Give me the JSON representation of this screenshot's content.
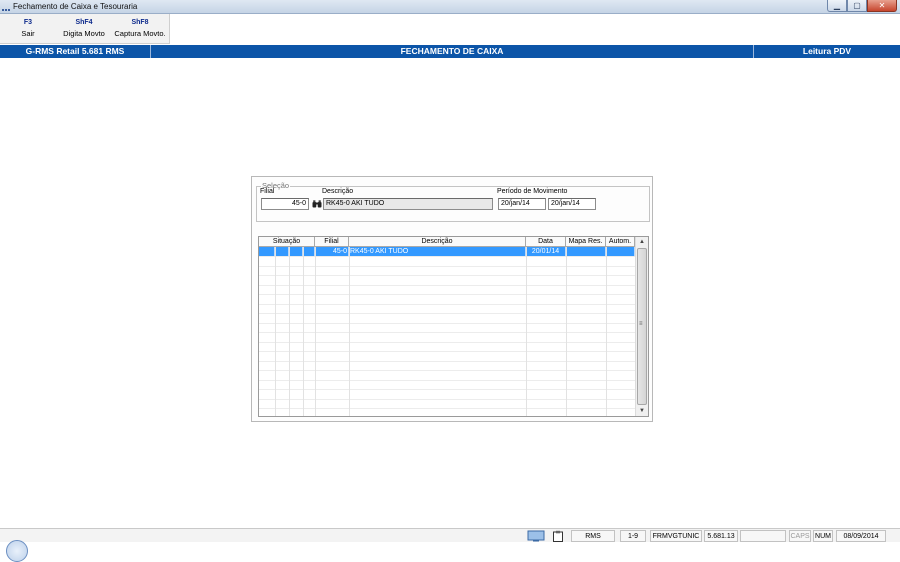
{
  "window": {
    "title": "Fechamento de Caixa e Tesouraria"
  },
  "fkeys": [
    {
      "key": "F3",
      "label": "Sair"
    },
    {
      "key": "ShF4",
      "label": "Digita Movto"
    },
    {
      "key": "ShF8",
      "label": "Captura Movto."
    }
  ],
  "header": {
    "left": "G-RMS Retail 5.681 RMS",
    "center": "FECHAMENTO DE CAIXA",
    "right": "Leitura PDV"
  },
  "selecao": {
    "legend": "Seleção",
    "filial_label": "Filial",
    "filial_value": "45-0",
    "descricao_label": "Descrição",
    "descricao_value": "RK45-0 AKI TUDO",
    "periodo_label": "Período de Movimento",
    "periodo_inicio": "20/jan/14",
    "periodo_fim": "20/jan/14"
  },
  "table": {
    "columns": [
      "Situação",
      "Filial",
      "Descrição",
      "Data",
      "Mapa Res.",
      "Autom."
    ],
    "rows": [
      {
        "filial": "45-0",
        "descricao": "RK45-0 AKI TUDO",
        "data": "20/01/14",
        "mapa": "",
        "autom": ""
      }
    ]
  },
  "statusbar": {
    "rms": "RMS",
    "range": "1-9",
    "program": "FRMVGTUNIC",
    "version": "5.681.13",
    "caps": "CAPS",
    "num": "NUM",
    "date": "08/09/2014"
  },
  "colors": {
    "header_blue": "#0c55a8",
    "selection": "#3399ff",
    "fkey_text": "#0d2a8c"
  }
}
